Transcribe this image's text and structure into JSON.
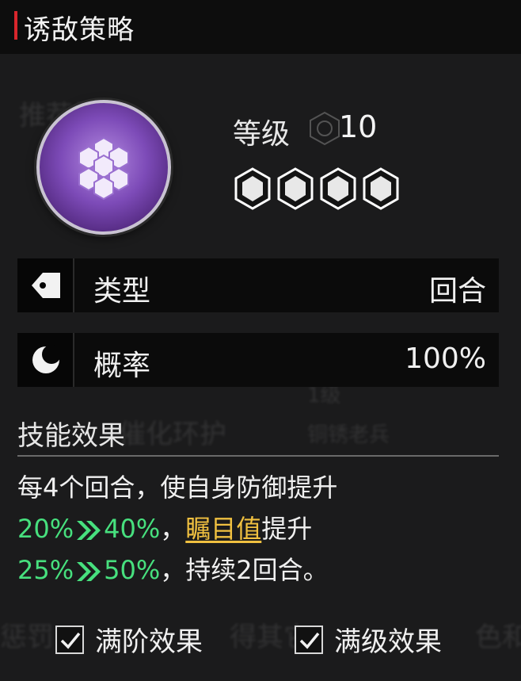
{
  "header": {
    "title": "诱敌策略"
  },
  "skill": {
    "icon": "hexagon-cluster-icon",
    "orb_color": "#8a55c8"
  },
  "level": {
    "label": "等级",
    "value": "10"
  },
  "stars": {
    "count": 4,
    "filled": 4
  },
  "rows": [
    {
      "icon": "tag-icon",
      "label": "类型",
      "value": "回合"
    },
    {
      "icon": "moon-icon",
      "label": "概率",
      "value": "100%"
    }
  ],
  "effect": {
    "title": "技能效果",
    "line1": "每4个回合，使自身防御提升",
    "line2_from": "20%",
    "line2_to": "40%",
    "line2_sep": "，",
    "line2_keyword": "瞩目值",
    "line2_tail": "提升",
    "line3_from": "25%",
    "line3_to": "50%",
    "line3_tail": "，持续2回合。"
  },
  "options": {
    "full_rank_label": "满阶效果",
    "full_level_label": "满级效果",
    "full_rank_checked": true,
    "full_level_checked": true
  },
  "colors": {
    "accent_red": "#d8262c",
    "green": "#47e07e",
    "gold": "#f0c040"
  }
}
